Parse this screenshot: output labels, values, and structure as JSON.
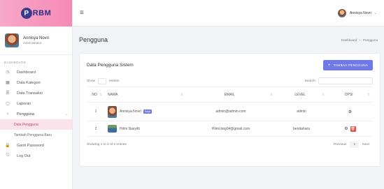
{
  "brand": {
    "logo_text": "RBM",
    "logo_mark": "P"
  },
  "profile": {
    "name": "Annisya Novri",
    "role": "Administrator"
  },
  "nav": {
    "section_title": "DASHBOARD",
    "items": [
      {
        "label": "Dashboard",
        "icon": "dashboard-icon",
        "glyph": "◷"
      },
      {
        "label": "Data Kategori",
        "icon": "category-icon",
        "glyph": "▦"
      },
      {
        "label": "Data Transaksi",
        "icon": "transaction-icon",
        "glyph": "☰"
      },
      {
        "label": "Laporan",
        "icon": "report-icon",
        "glyph": "▢"
      },
      {
        "label": "Pengguna",
        "icon": "user-icon",
        "glyph": "♀"
      }
    ],
    "sub_items": [
      {
        "label": "Data Pengguna"
      },
      {
        "label": "Tambah Pengguna Baru"
      }
    ],
    "bottom_items": [
      {
        "label": "Ganti Password",
        "icon": "lock-icon",
        "glyph": "🔒"
      },
      {
        "label": "Log Out",
        "icon": "logout-icon",
        "glyph": "⎋"
      }
    ]
  },
  "topbar": {
    "menu_glyph": "≡",
    "username": "Annisya Novri",
    "chevron": "⌄"
  },
  "page": {
    "title": "Pengguna",
    "breadcrumb": [
      "Dashboard",
      "Pengguna"
    ],
    "breadcrumb_sep": ">"
  },
  "card": {
    "title": "Data Pengguna Sistem",
    "add_button": "TAMBAH PENGGUNA",
    "add_plus": "+",
    "show_label": "Show",
    "entries_label": "entries",
    "search_label": "Search:",
    "columns": [
      "NO",
      "NAMA",
      "EMAIL",
      "LEVEL",
      "OPSI"
    ],
    "rows": [
      {
        "no": "1",
        "name": "Annisya Novri",
        "badge": "Saya",
        "email": "admin@admin.com",
        "level": "admin"
      },
      {
        "no": "2",
        "name": "Hilmi Nasyith",
        "badge": "",
        "email": "Hilmi.beg04@gmail.com",
        "level": "bendahara"
      }
    ],
    "footer_info": "Showing 1 to 2 of 2 entries",
    "pager": {
      "prev": "Previous",
      "current": "1",
      "next": "Next"
    }
  },
  "icons": {
    "sort": "⇅",
    "cog": "⚙",
    "trash": "🗑"
  },
  "colors": {
    "accent": "#6f79e8",
    "brand_pink": "#f58ab5",
    "danger": "#ef4b4b"
  }
}
